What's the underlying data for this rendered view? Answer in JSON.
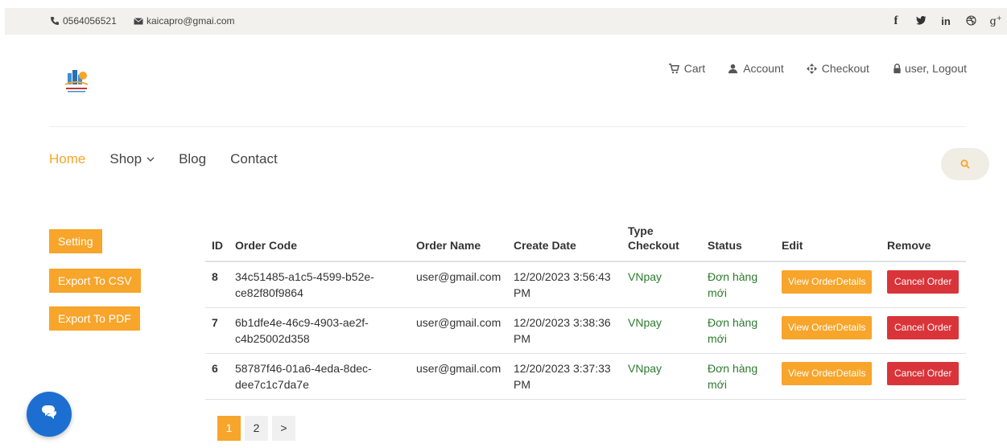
{
  "topbar": {
    "phone": "0564056521",
    "email": "kaicapro@gmai.com",
    "social": [
      "facebook-icon",
      "twitter-icon",
      "linkedin-icon",
      "dribbble-icon",
      "google-plus-icon"
    ]
  },
  "header": {
    "cart": "Cart",
    "account": "Account",
    "checkout": "Checkout",
    "user": "user, Logout"
  },
  "nav": {
    "home": "Home",
    "shop": "Shop",
    "blog": "Blog",
    "contact": "Contact"
  },
  "sidebar": {
    "setting": "Setting",
    "export_csv": "Export To CSV",
    "export_pdf": "Export To PDF"
  },
  "table": {
    "headers": {
      "id": "ID",
      "code": "Order Code",
      "name": "Order Name",
      "date": "Create Date",
      "type": "Type Checkout",
      "status": "Status",
      "edit": "Edit",
      "remove": "Remove"
    },
    "rows": [
      {
        "id": "8",
        "code": "34c51485-a1c5-4599-b52e-ce82f80f9864",
        "name": "user@gmail.com",
        "date": "12/20/2023 3:56:43 PM",
        "type": "VNpay",
        "status": "Đơn hàng mới",
        "edit": "View OrderDetails",
        "remove": "Cancel Order"
      },
      {
        "id": "7",
        "code": "6b1dfe4e-46c9-4903-ae2f-c4b25002d358",
        "name": "user@gmail.com",
        "date": "12/20/2023 3:38:36 PM",
        "type": "VNpay",
        "status": "Đơn hàng mới",
        "edit": "View OrderDetails",
        "remove": "Cancel Order"
      },
      {
        "id": "6",
        "code": "58787f46-01a6-4eda-8dec-dee7c1c7da7e",
        "name": "user@gmail.com",
        "date": "12/20/2023 3:37:33 PM",
        "type": "VNpay",
        "status": "Đơn hàng mới",
        "edit": "View OrderDetails",
        "remove": "Cancel Order"
      }
    ]
  },
  "pagination": {
    "pages": [
      "1",
      "2",
      ">"
    ],
    "current": "1"
  },
  "colors": {
    "accent": "#f7a52b",
    "danger": "#d9343a",
    "status_green": "#2f7a2f",
    "chat": "#1c6fd1"
  }
}
